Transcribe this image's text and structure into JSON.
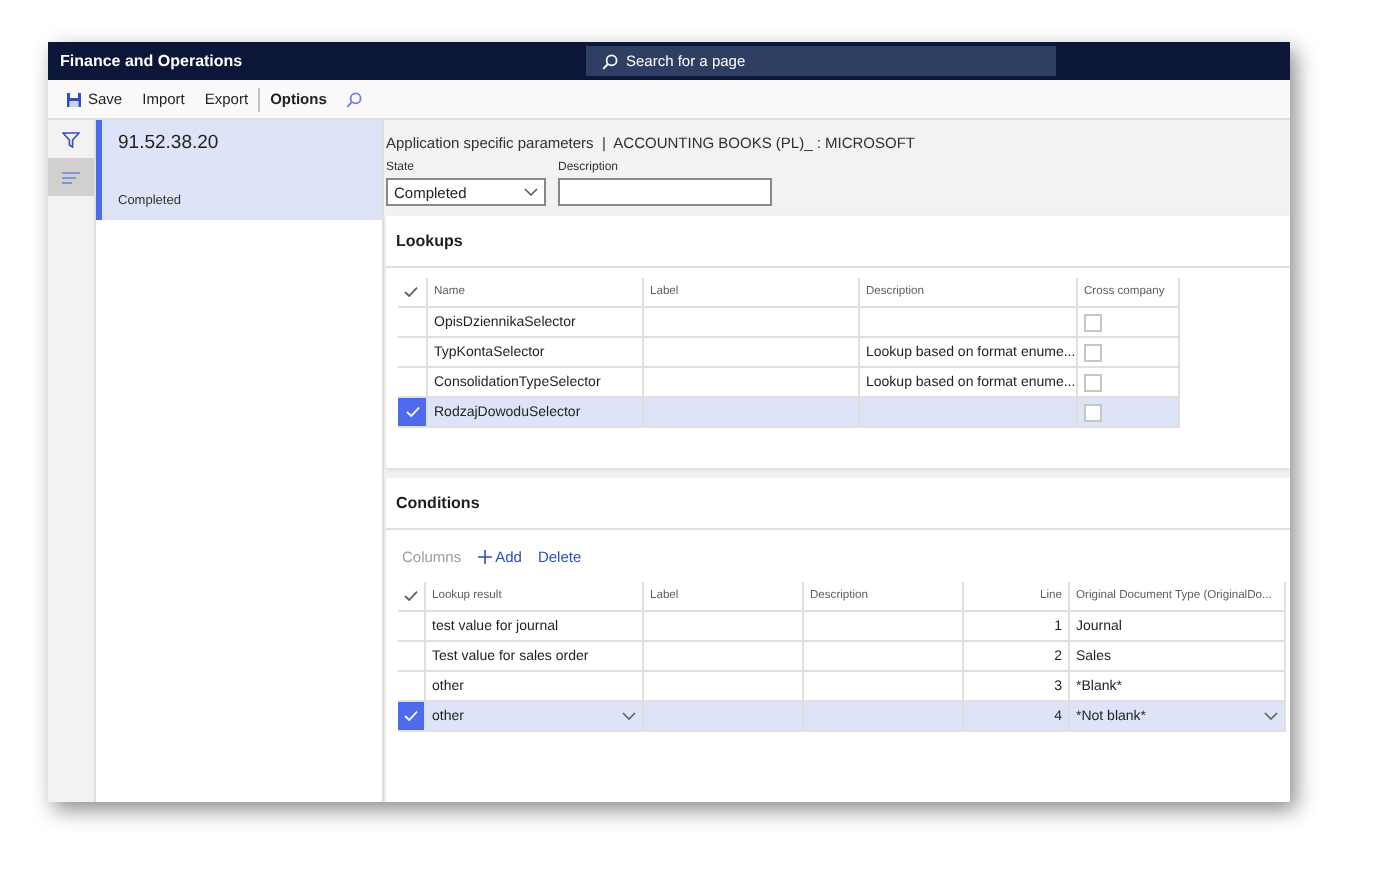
{
  "app_title": "Finance and Operations",
  "search": {
    "placeholder": "Search for a page"
  },
  "toolbar": [
    {
      "label": "Save",
      "kind": "save",
      "selected": false
    },
    {
      "label": "Import",
      "kind": "plain",
      "selected": false
    },
    {
      "label": "Export",
      "kind": "plain",
      "selected": false
    },
    {
      "label": "Options",
      "kind": "plain",
      "selected": true
    }
  ],
  "list": [
    {
      "title": "91.52.38.20",
      "status": "Completed",
      "selected": true
    }
  ],
  "breadcrumb": "Application specific parameters  |  ACCOUNTING BOOKS (PL)_ : MICROSOFT",
  "state_field": {
    "label": "State",
    "value": "Completed"
  },
  "description_field": {
    "label": "Description"
  },
  "lookups": {
    "title": "Lookups",
    "columns": [
      "Name",
      "Label",
      "Description",
      "Cross company"
    ],
    "rows": [
      {
        "name": "OpisDziennikaSelector",
        "description": "",
        "checked": false,
        "selected": false
      },
      {
        "name": "TypKontaSelector",
        "description": "Lookup based on format enume...",
        "checked": false,
        "selected": false
      },
      {
        "name": "ConsolidationTypeSelector",
        "description": "Lookup based on format enume...",
        "checked": false,
        "selected": false
      },
      {
        "name": "RodzajDowoduSelector",
        "description": "",
        "checked": false,
        "selected": true
      }
    ]
  },
  "conditions": {
    "title": "Conditions",
    "actions": [
      {
        "label": "Columns",
        "kind": "plain",
        "disabled": true
      },
      {
        "label": "Add",
        "kind": "add",
        "disabled": false
      },
      {
        "label": "Delete",
        "kind": "plain",
        "disabled": false
      }
    ],
    "columns": [
      "Lookup result",
      "Label",
      "Description",
      "Line",
      "Original Document Type (OriginalDo..."
    ],
    "rows": [
      {
        "result": "test value for journal",
        "line": "1",
        "doc_type": "Journal",
        "selected": false
      },
      {
        "result": "Test value for sales order",
        "line": "2",
        "doc_type": "Sales",
        "selected": false
      },
      {
        "result": "other",
        "line": "3",
        "doc_type": "*Blank*",
        "selected": false
      },
      {
        "result": "other",
        "line": "4",
        "doc_type": "*Not blank*",
        "selected": true
      }
    ]
  }
}
